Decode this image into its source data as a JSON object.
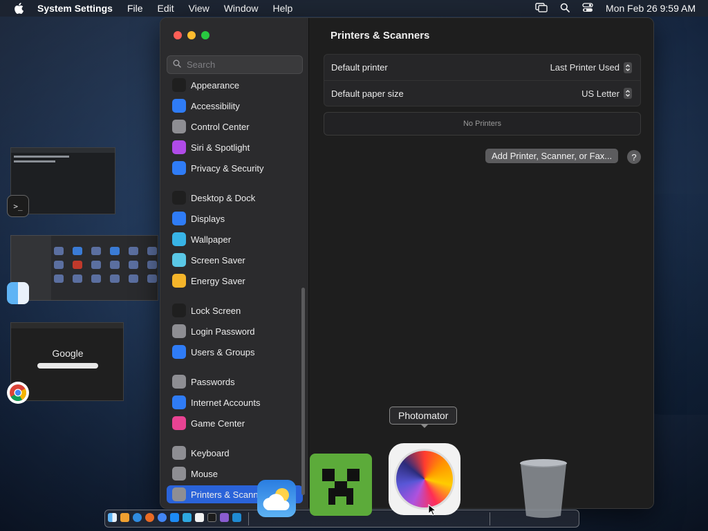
{
  "menubar": {
    "app_name": "System Settings",
    "menus": [
      "File",
      "Edit",
      "View",
      "Window",
      "Help"
    ],
    "clock": "Mon Feb 26  9:59 AM"
  },
  "desktop": {
    "chrome_thumb_text": "Google",
    "terminal_prompt": ">_"
  },
  "sidebar": {
    "search_placeholder": "Search",
    "items": [
      {
        "label": "Appearance",
        "icon": "appearance-icon",
        "color": "#1f1f1f"
      },
      {
        "label": "Accessibility",
        "icon": "accessibility-icon",
        "color": "#2f7cf6"
      },
      {
        "label": "Control Center",
        "icon": "control-center-icon",
        "color": "#8e8e93"
      },
      {
        "label": "Siri & Spotlight",
        "icon": "siri-icon",
        "color": "#b04be8"
      },
      {
        "label": "Privacy & Security",
        "icon": "hand-icon",
        "color": "#2f7cf6"
      },
      {
        "label": "Desktop & Dock",
        "icon": "dock-icon",
        "color": "#1f1f1f"
      },
      {
        "label": "Displays",
        "icon": "sun-icon",
        "color": "#2f7cf6"
      },
      {
        "label": "Wallpaper",
        "icon": "wallpaper-icon",
        "color": "#38b4e6"
      },
      {
        "label": "Screen Saver",
        "icon": "screen-saver-icon",
        "color": "#5ac8e6"
      },
      {
        "label": "Energy Saver",
        "icon": "bulb-icon",
        "color": "#f5b52a"
      },
      {
        "label": "Lock Screen",
        "icon": "lock-icon",
        "color": "#1f1f1f"
      },
      {
        "label": "Login Password",
        "icon": "padlock-icon",
        "color": "#8e8e93"
      },
      {
        "label": "Users & Groups",
        "icon": "users-icon",
        "color": "#2f7cf6"
      },
      {
        "label": "Passwords",
        "icon": "key-icon",
        "color": "#8e8e93"
      },
      {
        "label": "Internet Accounts",
        "icon": "at-icon",
        "color": "#2f7cf6"
      },
      {
        "label": "Game Center",
        "icon": "game-center-icon",
        "color": "#e84393"
      },
      {
        "label": "Keyboard",
        "icon": "keyboard-icon",
        "color": "#8e8e93"
      },
      {
        "label": "Mouse",
        "icon": "mouse-icon",
        "color": "#8e8e93"
      },
      {
        "label": "Printers & Scanners",
        "icon": "printer-icon",
        "color": "#8e8e93",
        "selected": true
      }
    ]
  },
  "content": {
    "title": "Printers & Scanners",
    "default_printer_label": "Default printer",
    "default_printer_value": "Last Printer Used",
    "paper_size_label": "Default paper size",
    "paper_size_value": "US Letter",
    "no_printers": "No Printers",
    "add_button": "Add Printer, Scanner, or Fax...",
    "help": "?"
  },
  "dock": {
    "tooltip": "Photomator"
  }
}
